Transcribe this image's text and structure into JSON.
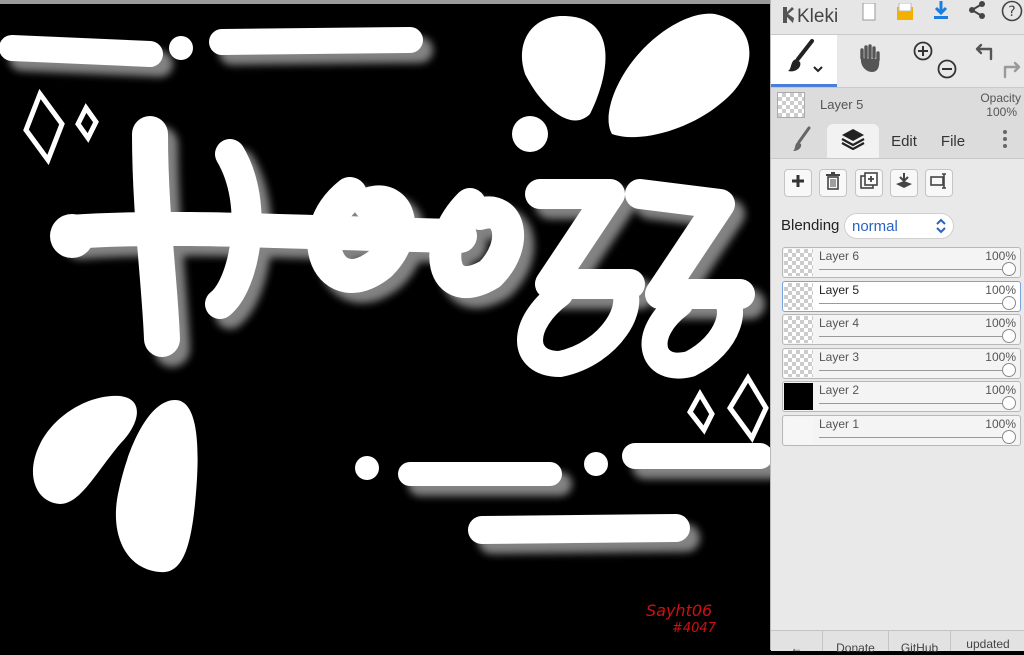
{
  "app": {
    "name": "Kleki"
  },
  "header": {
    "icons": [
      "kleki-logo-icon",
      "new-document-icon",
      "open-folder-icon",
      "download-icon",
      "share-icon",
      "help-icon"
    ]
  },
  "tools": {
    "icons": [
      "brush-icon",
      "hand-icon",
      "zoom-in-icon",
      "zoom-out-icon",
      "undo-icon",
      "redo-icon"
    ]
  },
  "current_layer": {
    "name": "Layer 5",
    "opacity_label": "Opacity",
    "opacity_value": "100%"
  },
  "tabs": [
    {
      "label": "",
      "icon": "brush-tab-icon"
    },
    {
      "label": "",
      "icon": "layers-icon",
      "active": true
    },
    {
      "label": "Edit"
    },
    {
      "label": "File"
    },
    {
      "label": "",
      "icon": "more-vertical-icon"
    }
  ],
  "layer_actions": [
    "add-layer-icon",
    "delete-layer-icon",
    "duplicate-layer-icon",
    "merge-down-icon",
    "rename-layer-icon"
  ],
  "blending": {
    "label": "Blending",
    "value": "normal"
  },
  "layers": [
    {
      "name": "Layer 6",
      "opacity": "100%",
      "thumb": "transparent"
    },
    {
      "name": "Layer 5",
      "opacity": "100%",
      "thumb": "transparent",
      "selected": true
    },
    {
      "name": "Layer 4",
      "opacity": "100%",
      "thumb": "transparent"
    },
    {
      "name": "Layer 3",
      "opacity": "100%",
      "thumb": "transparent"
    },
    {
      "name": "Layer 2",
      "opacity": "100%",
      "thumb": "black"
    },
    {
      "name": "Layer 1",
      "opacity": "100%",
      "thumb": "white"
    }
  ],
  "footer": {
    "back_label": "←",
    "donate_label": "Donate",
    "github_label": "GitHub",
    "updated_label": "updated"
  },
  "canvas": {
    "signature_line1": "Sayht06",
    "signature_line2": "#4047"
  },
  "colors": {
    "accent": "#2a62c4",
    "canvas_bg": "#000000",
    "stroke": "#ffffff",
    "signature": "#d01010"
  }
}
